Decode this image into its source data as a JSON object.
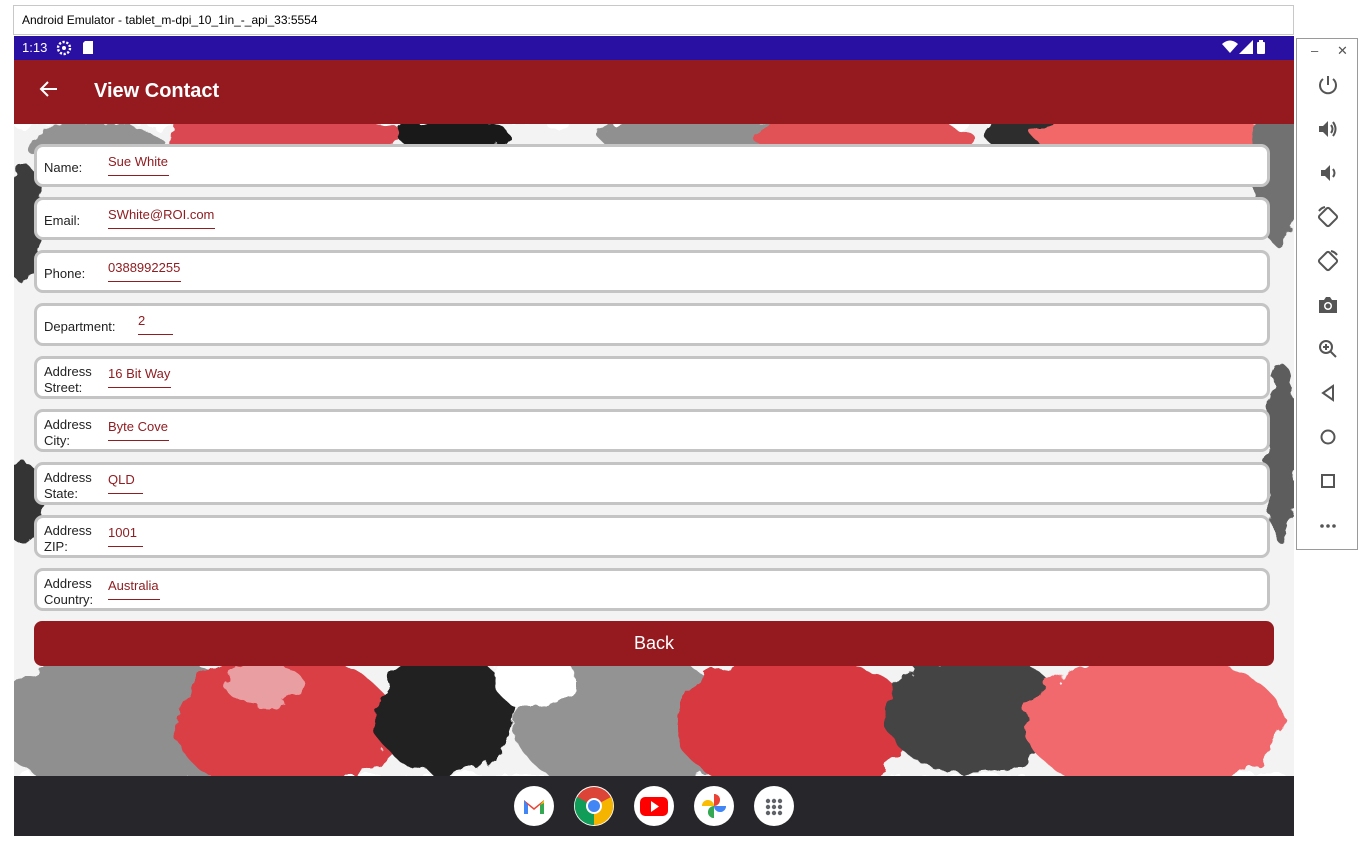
{
  "window": {
    "title": "Android Emulator - tablet_m-dpi_10_1in_-_api_33:5554"
  },
  "statusbar": {
    "time": "1:13"
  },
  "appbar": {
    "title": "View Contact"
  },
  "fields": [
    {
      "label": "Name:",
      "value": "Sue White"
    },
    {
      "label": "Email:",
      "value": "SWhite@ROI.com"
    },
    {
      "label": "Phone:",
      "value": "0388992255"
    },
    {
      "label": "Department:",
      "value": "2"
    },
    {
      "label": "Address Street:",
      "value": "16 Bit Way"
    },
    {
      "label": "Address City:",
      "value": "Byte Cove"
    },
    {
      "label": "Address State:",
      "value": "QLD"
    },
    {
      "label": "Address ZIP:",
      "value": "1001"
    },
    {
      "label": "Address Country:",
      "value": "Australia"
    }
  ],
  "back_button": {
    "label": "Back"
  },
  "dock": [
    "gmail-icon",
    "chrome-icon",
    "youtube-icon",
    "photos-icon",
    "app-drawer-icon"
  ],
  "side_controls": [
    "power-icon",
    "volume-up-icon",
    "volume-down-icon",
    "rotate-left-icon",
    "rotate-right-icon",
    "camera-icon",
    "zoom-icon",
    "back-triangle-icon",
    "home-circle-icon",
    "overview-square-icon",
    "more-icon"
  ],
  "colors": {
    "statusbar": "#2a0fa3",
    "appbar": "#951a1f",
    "value_text": "#8f1e22",
    "navbar": "#26262b"
  }
}
